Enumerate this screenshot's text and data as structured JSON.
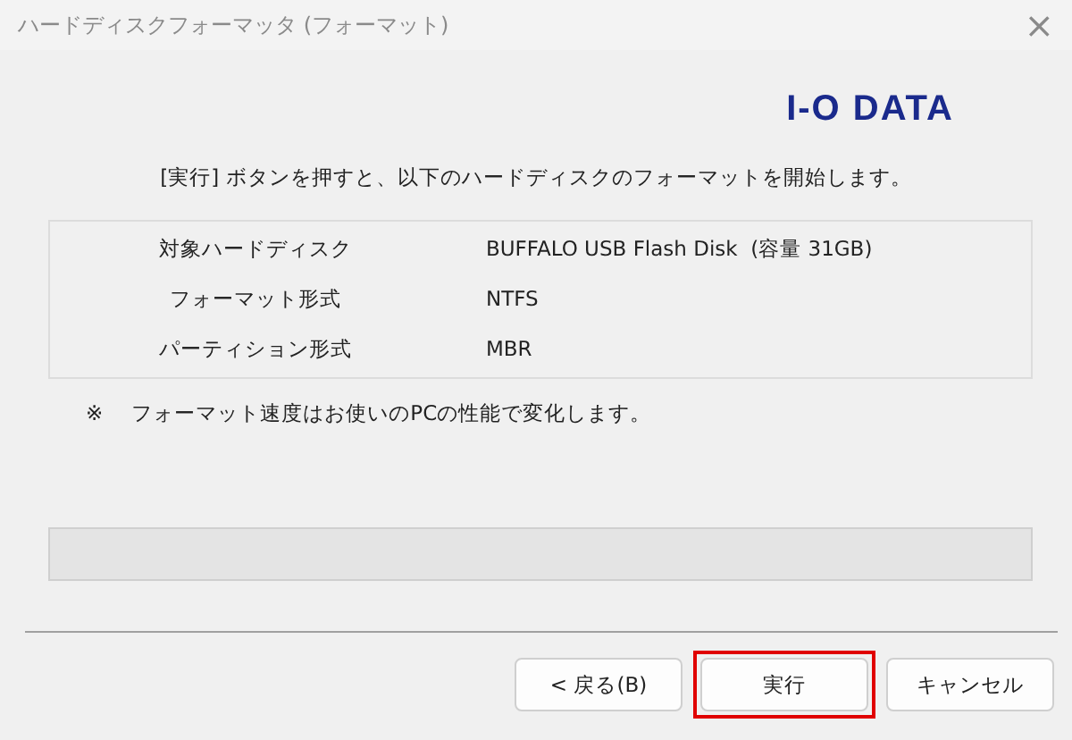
{
  "window": {
    "title": "ハードディスクフォーマッタ (フォーマット)",
    "close": "×"
  },
  "logo": "I-O DATA",
  "message": "[実行] ボタンを押すと、以下のハードディスクのフォーマットを開始します。",
  "details": [
    {
      "label": "対象ハードディスク",
      "value": "BUFFALO USB Flash Disk  (容量 31GB)"
    },
    {
      "label": "フォーマット形式",
      "value": "NTFS"
    },
    {
      "label": "パーティション形式",
      "value": "MBR"
    }
  ],
  "note": {
    "mark": "※",
    "text": "フォーマット速度はお使いのPCの性能で変化します。"
  },
  "progress": {
    "level": 0
  },
  "buttons": [
    {
      "label": "< 戻る(B)",
      "highlighted": false
    },
    {
      "label": "実行",
      "highlighted": true
    },
    {
      "label": "キャンセル",
      "highlighted": false
    }
  ]
}
